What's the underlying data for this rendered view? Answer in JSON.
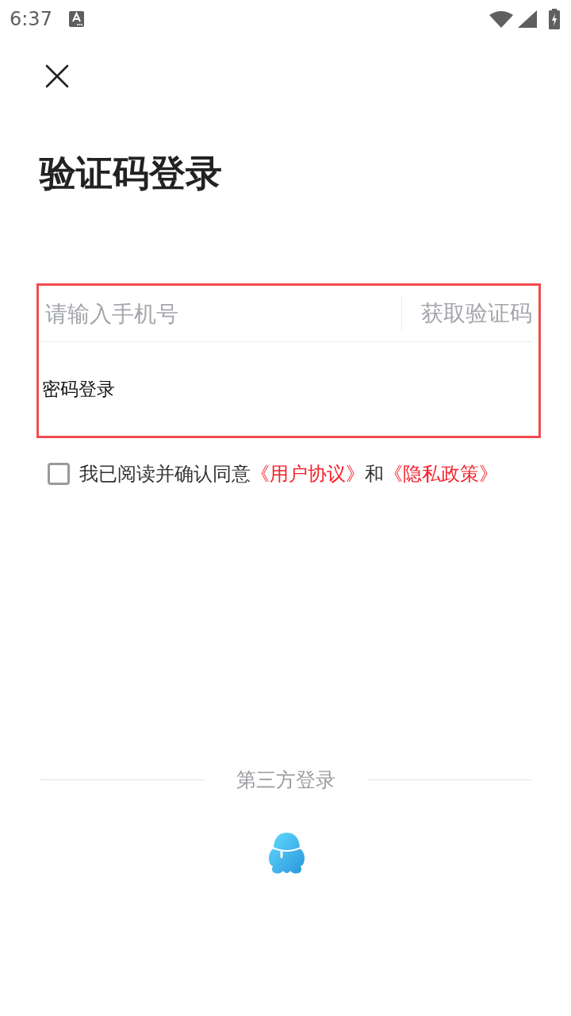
{
  "status_bar": {
    "time": "6:37"
  },
  "title": "验证码登录",
  "login_form": {
    "highlighted": true,
    "phone_field": {
      "placeholder": "请输入手机号"
    },
    "get_code_button": "获取验证码",
    "password_login_link": "密码登录"
  },
  "agreement": {
    "checked": false,
    "parts": [
      {
        "kind": "text",
        "text": "我已阅读并确认同意"
      },
      {
        "kind": "link",
        "text": "《用户协议》"
      },
      {
        "kind": "text",
        "text": "和"
      },
      {
        "kind": "link",
        "text": "《隐私政策》"
      }
    ]
  },
  "third_party": {
    "label": "第三方登录"
  }
}
